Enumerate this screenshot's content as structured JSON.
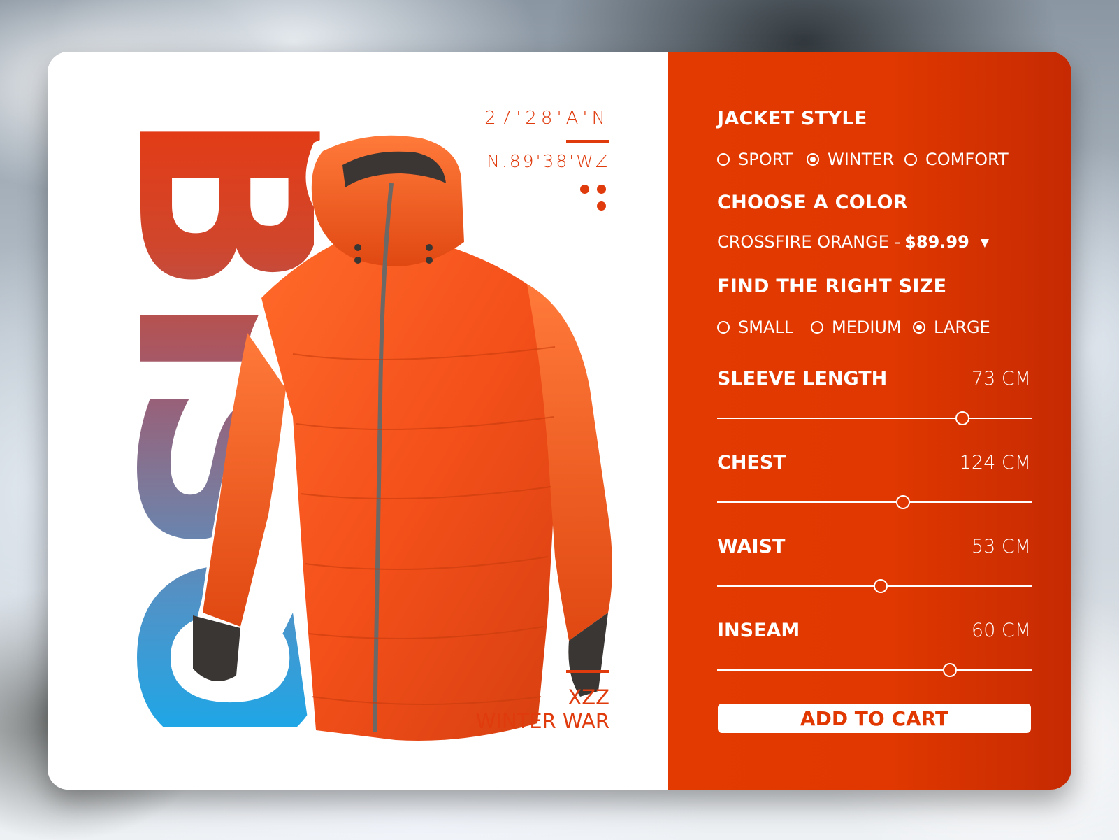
{
  "brand": {
    "title": "BISON",
    "coord_line1": "27'28'A'N",
    "coord_line2": "N.89'38'WZ",
    "tag_line1": "XZZ",
    "tag_line2": "WINTER WAR"
  },
  "style": {
    "title": "JACKET STYLE",
    "options": [
      {
        "label": "SPORT",
        "selected": false
      },
      {
        "label": "WINTER",
        "selected": true
      },
      {
        "label": "COMFORT",
        "selected": false
      }
    ]
  },
  "color": {
    "title": "CHOOSE A COLOR",
    "selected": "CROSSFIRE ORANGE -",
    "price": "$89.99",
    "caret": "▼"
  },
  "size": {
    "title": "FIND THE RIGHT SIZE",
    "options": [
      {
        "label": "SMALL",
        "selected": false
      },
      {
        "label": "MEDIUM",
        "selected": false
      },
      {
        "label": "LARGE",
        "selected": true
      }
    ]
  },
  "measurements": [
    {
      "label": "SLEEVE LENGTH",
      "value": "73 CM",
      "level": 0.78
    },
    {
      "label": "CHEST",
      "value": "124 CM",
      "level": 0.59
    },
    {
      "label": "WAIST",
      "value": "53 CM",
      "level": 0.52
    },
    {
      "label": "INSEAM",
      "value": "60 CM",
      "level": 0.74
    }
  ],
  "cart": {
    "label": "ADD TO CART"
  },
  "colors": {
    "accent": "#e03800",
    "panel": "#e23a00",
    "white": "#ffffff"
  }
}
